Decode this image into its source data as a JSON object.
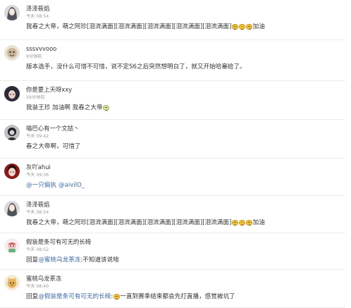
{
  "comments": [
    {
      "avatar_icon": "girl-avatar-icon",
      "username": "泽泽筱焰",
      "time": "今天 08:54",
      "parts": [
        {
          "t": "我春之大帝，萌之阿珍[泪流满面][泪流满面][泪流满面][泪流满面][泪流满面]"
        },
        {
          "e": "smile-emoji"
        },
        {
          "e": "smile-emoji"
        },
        {
          "e": "smile-emoji"
        },
        {
          "t": "加油"
        }
      ]
    },
    {
      "avatar_icon": "cartoon-avatar-icon",
      "username": "sssvvvooo",
      "time": "9分钟前",
      "parts": [
        {
          "t": "版本选手，没什么可惜不可惜，说不定S6之后突然想明白了，就又开始哈塞给了。"
        }
      ]
    },
    {
      "avatar_icon": "anime-avatar-icon",
      "username": "你是要上天呀xxy",
      "time": "29分钟前",
      "parts": [
        {
          "t": "我装王珍 加油啊 我春之大帝"
        },
        {
          "e": "green-emoji"
        }
      ]
    },
    {
      "avatar_icon": "dark-avatar-icon",
      "username": "喵巴心有一个文喆丶",
      "time": "今天 09:42",
      "parts": [
        {
          "t": "春之大帝啊，可惜了"
        }
      ]
    },
    {
      "avatar_icon": "red-avatar-icon",
      "username": "灰吖ahui",
      "time": "今天 09:36",
      "parts": [
        {
          "l": "@一只偏执"
        },
        {
          "t": " "
        },
        {
          "l": "@aivilO_"
        }
      ]
    },
    {
      "avatar_icon": "girl-avatar-icon",
      "username": "泽泽筱焰",
      "time": "今天 08:54",
      "parts": [
        {
          "t": "我春之大帝，萌之阿珍[泪流满面][泪流满面][泪流满面][泪流满面][泪流满面]"
        },
        {
          "e": "smile-emoji"
        },
        {
          "e": "smile-emoji"
        },
        {
          "e": "smile-emoji"
        },
        {
          "t": "加油"
        }
      ]
    },
    {
      "avatar_icon": "doll-avatar-icon",
      "username": "假装是条可有可无的长椅",
      "time": "今天 08:52",
      "parts": [
        {
          "t": "回复"
        },
        {
          "l": "@蜜桃乌龙茶冻"
        },
        {
          "t": ":不知道该说啥"
        }
      ]
    },
    {
      "avatar_icon": "cat-avatar-icon",
      "username": "蜜桃乌龙茶冻",
      "time": "今天 08:40",
      "parts": [
        {
          "t": "回复"
        },
        {
          "l": "@假装是条可有可无的长椅"
        },
        {
          "t": ":"
        },
        {
          "e": "smile-emoji"
        },
        {
          "t": "一直到赛季结束都会先打直播，感觉被坑了"
        }
      ]
    }
  ]
}
